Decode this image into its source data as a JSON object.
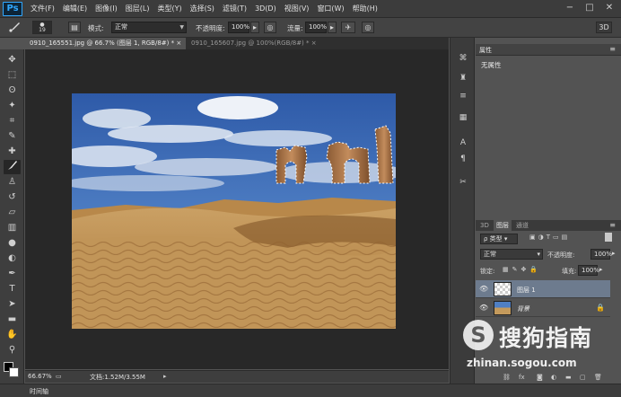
{
  "app": {
    "logo": "Ps",
    "menu": [
      "文件(F)",
      "编辑(E)",
      "图像(I)",
      "图层(L)",
      "类型(Y)",
      "选择(S)",
      "滤镜(T)",
      "3D(D)",
      "视图(V)",
      "窗口(W)",
      "帮助(H)"
    ],
    "window_controls": [
      "−",
      "□",
      "✕"
    ]
  },
  "options": {
    "brush_size": "19",
    "mode_label": "模式:",
    "mode_value": "正常",
    "opacity_label": "不透明度:",
    "opacity_value": "100%",
    "flow_label": "流量:",
    "flow_value": "100%",
    "workspace_badge": "3D"
  },
  "tabs": [
    {
      "label": "0910_165551.jpg @ 66.7% (图层 1, RGB/8#) * ×",
      "active": true
    },
    {
      "label": "0910_165607.jpg @ 100%(RGB/8#) * ×",
      "active": false
    }
  ],
  "status": {
    "zoom": "66.67%",
    "doc": "文档:1.52M/3.55M"
  },
  "timeline": {
    "label": "时间轴"
  },
  "properties": {
    "title": "属性",
    "empty_text": "无属性"
  },
  "layers": {
    "tabs": [
      "3D",
      "图层",
      "通道"
    ],
    "filter_kind": "类型",
    "blend_mode": "正常",
    "opacity_label": "不透明度:",
    "opacity_value": "100%",
    "lock_label": "锁定:",
    "fill_label": "填充:",
    "fill_value": "100%",
    "items": [
      {
        "name": "图层 1",
        "selected": true
      },
      {
        "name": "背景",
        "selected": false
      }
    ]
  },
  "watermark": {
    "badge": "S",
    "title": "搜狗指南",
    "url": "zhinan.sogou.com"
  },
  "colors": {
    "accent": "#31a8ff",
    "selected_layer": "#6d7b8e",
    "panel_bg": "#535353",
    "workspace_bg": "#282828"
  }
}
